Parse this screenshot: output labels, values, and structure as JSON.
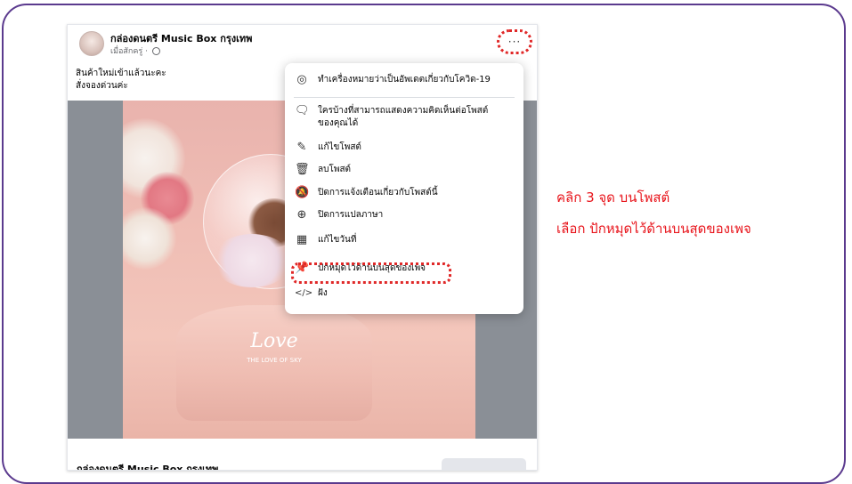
{
  "post": {
    "page_name": "กล่องดนตรี Music Box กรุงเทพ",
    "time": "เมื่อสักครู่ ·",
    "caption_line1": "สินค้าใหม่เข้าแล้วนะคะ",
    "caption_line2": "สั่งจองด่วนค่ะ",
    "more_label": "···",
    "photo_text_love": "Love",
    "photo_text_sub": "THE LOVE OF SKY",
    "footer_name": "กล่องดนตรี Music Box กรุงเทพ"
  },
  "menu": {
    "items": [
      {
        "icon": "covid-info-icon",
        "glyph": "◎",
        "label": "ทำเครื่องหมายว่าเป็นอัพเดตเกี่ยวกับโควิด-19"
      },
      {
        "icon": "comment-icon",
        "glyph": "🗨",
        "label": "ใครบ้างที่สามารถแสดงความคิดเห็นต่อโพสต์",
        "label2": "ของคุณได้"
      },
      {
        "icon": "pencil-icon",
        "glyph": "✎",
        "label": "แก้ไขโพสต์"
      },
      {
        "icon": "trash-icon",
        "glyph": "🗑",
        "label": "ลบโพสต์"
      },
      {
        "icon": "bell-off-icon",
        "glyph": "🔕",
        "label": "ปิดการแจ้งเตือนเกี่ยวกับโพสต์นี้"
      },
      {
        "icon": "translate-icon",
        "glyph": "⊕",
        "label": "ปิดการแปลภาษา"
      },
      {
        "icon": "calendar-icon",
        "glyph": "▦",
        "label": "แก้ไขวันที่"
      },
      {
        "icon": "pin-icon",
        "glyph": "📌",
        "label": "ปักหมุดไว้ด้านบนสุดของเพจ"
      },
      {
        "icon": "embed-icon",
        "glyph": "</>",
        "label": "ฝัง"
      }
    ]
  },
  "instructions": {
    "line1": "คลิก 3 จุด บนโพสต์",
    "line2": "เลือก ปักหมุดไว้ด้านบนสุดของเพจ"
  },
  "colors": {
    "accent_red": "#e8141b",
    "frame_purple": "#5b3a8e"
  }
}
